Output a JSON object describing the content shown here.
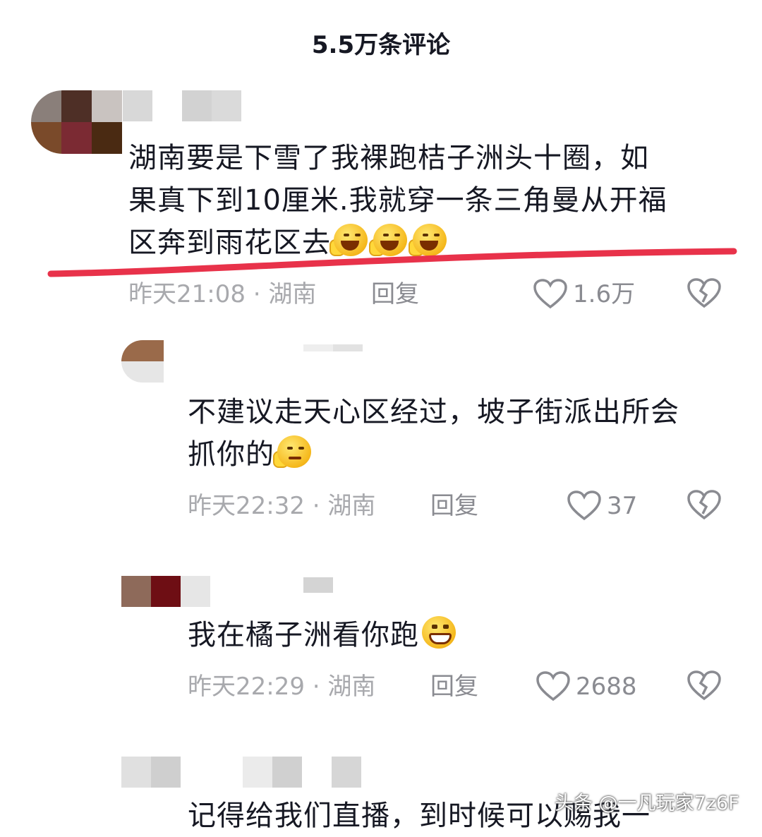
{
  "header": {
    "title": "5.5万条评论"
  },
  "comments": [
    {
      "text_lines": [
        "湖南要是下雪了我裸跑桔子洲头十圈，如",
        "果真下到10厘米.我就穿一条三角曼从开福",
        "区奔到雨花区去"
      ],
      "emojis": [
        "laugh",
        "laugh",
        "laugh"
      ],
      "time": "昨天21:08 · 湖南",
      "reply_label": "回复",
      "likes": "1.6万"
    },
    {
      "text_lines": [
        "不建议走天心区经过，坡子街派出所会",
        "抓你的"
      ],
      "emojis": [
        "smirk"
      ],
      "time": "昨天22:32 · 湖南",
      "reply_label": "回复",
      "likes": "37"
    },
    {
      "text_lines": [
        "我在橘子洲看你跑"
      ],
      "emojis": [
        "grin"
      ],
      "time": "昨天22:29 · 湖南",
      "reply_label": "回复",
      "likes": "2688"
    },
    {
      "text_lines": [
        "记得给我们直播，到时候可以赐我一"
      ]
    }
  ],
  "colors": {
    "underline": "#e8324a",
    "meta": "#a8a9ad",
    "text": "#161823"
  },
  "watermark": {
    "text": "头条 @一凡玩家7z6F"
  }
}
